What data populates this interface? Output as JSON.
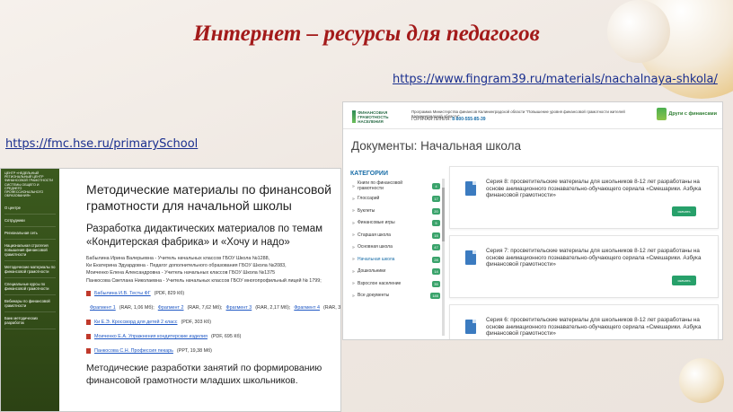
{
  "slide": {
    "title": "Интернет – ресурсы для педагогов",
    "link_top": "https://www.fingram39.ru/materials/nachalnaya-shkola/",
    "link_left": "https://fmc.hse.ru/primarySchool"
  },
  "left_site": {
    "org_text": "ЦЕНТР «НЕДЕЛЬНЫЙ РЕГИОНАЛЬНЫЙ ЦЕНТР ФИНАНСОВОЙ ГРАМОТНОСТИ СИСТЕМЫ ОБЩЕГО И СРЕДНЕГО ПРОФЕССИОНАЛЬНОГО ОБРАЗОВАНИЯ»",
    "nav": [
      "О центре",
      "Сотрудники",
      "Региональная сеть",
      "Национальная стратегия повышения финансовой грамотности",
      "Методические материалы по финансовой грамотности",
      "Специальные курсы по финансовой грамотности",
      "Вебинары по финансовой грамотности",
      "Банк методических разработок"
    ],
    "heading": "Методические материалы по финансовой грамотности для начальной школы",
    "subheading": "Разработка дидактических материалов по темам «Кондитерская фабрика» и «Хочу и надо»",
    "authors": [
      "Бабылина Ирина Валерьевна - Учитель начальных классов ГБОУ Школа №1288,",
      "Ки Екатерина Эдуардовна - Педагог дополнительного образования ГБОУ Школа №2083,",
      "Моиченко Елена Александровна - Учитель начальных классов ГБОУ Школа №1375",
      "Панкосова Светлана Николаевна - Учитель начальных классов ГБОУ многопрофильный лицей № 1799;"
    ],
    "resources": {
      "r1_link": "Бабылина И.В. Тесты ФГ",
      "r1_meta": "(PDF, 829 Кб)",
      "r2_a": "Фрагмент 1",
      "r2_a_meta": "(RAR, 1,06 Мб);",
      "r2_b": "Фрагмент 2",
      "r2_b_meta": "(RAR, 7,62 Мб);",
      "r2_c": "Фрагмент 3",
      "r2_c_meta": "(RAR, 2,17 Мб);",
      "r2_d": "Фрагмент 4",
      "r2_d_meta": "(RAR, 3,52 Мб)",
      "r3_link": "Ки Е.Э. Кроссворд для детей 2 класс",
      "r3_meta": "(PDF, 303 Кб)",
      "r4_link": "Моиченко Е.А. Упражнения кондитерские изделия",
      "r4_meta": "(PDF, 695 Кб)",
      "r5_link": "Панкосова С.Н. Профессия пекарь",
      "r5_meta": "(PPT, 19,38 Мб)"
    },
    "heading2": "Методические разработки занятий по формированию финансовой грамотности младших школьников."
  },
  "right_site": {
    "logo_text": "ФИНАНСОВАЯ ГРАМОТНОСТЬ НАСЕЛЕНИЯ",
    "program_text": "Программа Министерства финансов Калининградской области \"Повышение уровня финансовой грамотности жителей Калининградской области\"",
    "hotline_label": "ГОРЯЧАЯ ЛИНИЯ:",
    "hotline_number": "8-800-555-85-39",
    "friends_text": "Други с финансами",
    "page_title": "Документы: Начальная школа",
    "categories_heading": "КАТЕГОРИИ",
    "categories": [
      {
        "label": "Книги по финансовой грамотности",
        "count": "4"
      },
      {
        "label": "Глоссарий",
        "count": "17"
      },
      {
        "label": "Буклеты",
        "count": "20"
      },
      {
        "label": "Финансовые игры",
        "count": "5"
      },
      {
        "label": "Старшая школа",
        "count": "15"
      },
      {
        "label": "Основная школа",
        "count": "47"
      },
      {
        "label": "Начальная школа",
        "count": "28"
      },
      {
        "label": "Дошкольники",
        "count": "14"
      },
      {
        "label": "Взрослое население",
        "count": "35"
      },
      {
        "label": "Все документы",
        "count": "185"
      }
    ],
    "docs": [
      {
        "text": "Серия 8: просветительские материалы для школьников 8-12 лет разработаны на основе анимационного познавательно-обучающего сериала «Смешарики. Азбука финансовой грамотности»",
        "button": "скачать"
      },
      {
        "text": "Серия 7: просветительские материалы для школьников 8-12 лет разработаны на основе анимационного познавательно-обучающего сериала «Смешарики. Азбука финансовой грамотности»",
        "button": "скачать"
      },
      {
        "text": "Серия 6: просветительские материалы для школьников 8-12 лет разработаны на основе анимационного познавательно-обучающего сериала «Смешарики. Азбука финансовой грамотности»",
        "button": "скачать"
      }
    ]
  },
  "colors": {
    "title": "#a31a1a",
    "link": "#1a2f8f",
    "accent_green": "#3aa36b",
    "accent_blue": "#1a6ea8"
  }
}
